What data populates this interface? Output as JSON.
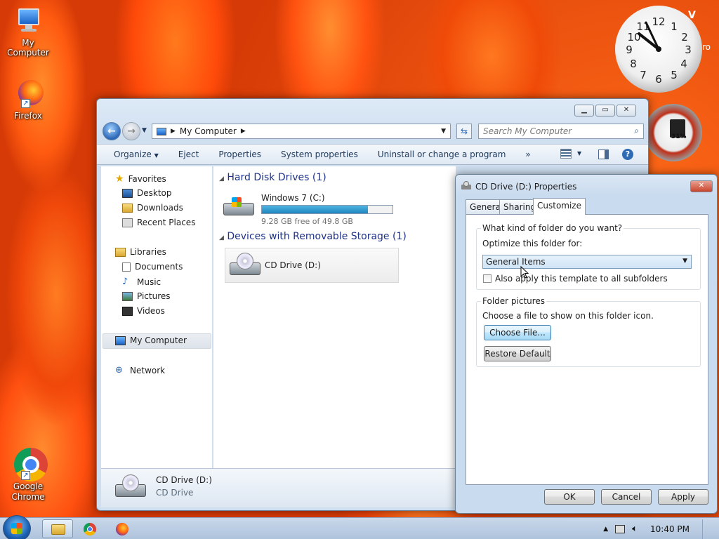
{
  "desktop": {
    "icons": [
      {
        "label": "My Computer"
      },
      {
        "label": "Firefox"
      },
      {
        "label": "Google Chrome"
      }
    ],
    "gauge_text": "31%",
    "partial_text_1": "V",
    "partial_text_2": "ro"
  },
  "explorer": {
    "address": "My Computer",
    "search_placeholder": "Search My Computer",
    "toolbar": [
      "Organize",
      "Eject",
      "Properties",
      "System properties",
      "Uninstall or change a program",
      "»"
    ],
    "nav": {
      "favorites": "Favorites",
      "favorites_items": [
        "Desktop",
        "Downloads",
        "Recent Places"
      ],
      "libraries": "Libraries",
      "libraries_items": [
        "Documents",
        "Music",
        "Pictures",
        "Videos"
      ],
      "computer": "My Computer",
      "network": "Network"
    },
    "groups": {
      "hdd": "Hard Disk Drives (1)",
      "removable": "Devices with Removable Storage (1)"
    },
    "drive_c": {
      "name": "Windows 7 (C:)",
      "free": "9.28 GB free of 49.8 GB",
      "used_fraction": 0.81
    },
    "drive_d": {
      "name": "CD Drive (D:)"
    },
    "details": {
      "name": "CD Drive (D:)",
      "type": "CD Drive"
    }
  },
  "dialog": {
    "title": "CD Drive (D:) Properties",
    "close": "✕",
    "tabs": [
      "General",
      "Sharing",
      "Customize"
    ],
    "active_tab": "Customize",
    "section1_legend": "What kind of folder do you want?",
    "optimize_label": "Optimize this folder for:",
    "optimize_value": "General Items",
    "subfolders_checkbox": "Also apply this template to all subfolders",
    "subfolders_checked": false,
    "section2_legend": "Folder pictures",
    "choose_label": "Choose a file to show on this folder icon.",
    "choose_button": "Choose File...",
    "restore_button": "Restore Default",
    "ok": "OK",
    "cancel": "Cancel",
    "apply": "Apply"
  },
  "taskbar": {
    "time": "10:40 PM"
  }
}
